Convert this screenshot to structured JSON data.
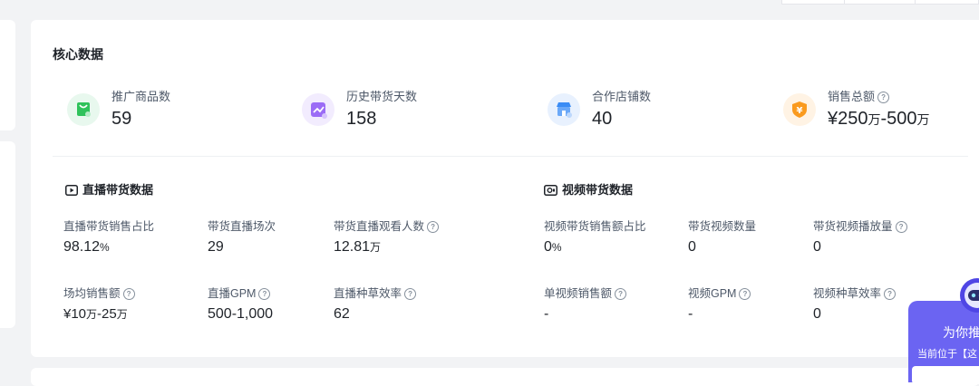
{
  "core": {
    "title": "核心数据",
    "metrics": [
      {
        "label": "推广商品数",
        "value": "59",
        "icon": "shopping-bag-icon",
        "color": "#2fc25b"
      },
      {
        "label": "历史带货天数",
        "value": "158",
        "icon": "trend-chart-icon",
        "color": "#9b6cf6"
      },
      {
        "label": "合作店铺数",
        "value": "40",
        "icon": "store-icon",
        "color": "#3a8cf5"
      },
      {
        "label": "销售总额",
        "value_prefix": "¥250",
        "unit1": "万",
        "value_mid": "-500",
        "unit2": "万",
        "icon": "yuan-shield-icon",
        "color": "#fa9a1e"
      }
    ]
  },
  "live": {
    "title": "直播带货数据",
    "icon": "play-icon",
    "cells": [
      {
        "label": "直播带货销售占比",
        "value": "98.12",
        "unit": "%"
      },
      {
        "label": "带货直播场次",
        "value": "29"
      },
      {
        "label": "带货直播观看人数",
        "value": "12.81",
        "unit": "万"
      },
      {
        "label": "场均销售额",
        "value": "¥10",
        "unit": "万",
        "value2": "-25",
        "unit2": "万"
      },
      {
        "label": "直播GPM",
        "value": "500-1,000"
      },
      {
        "label": "直播种草效率",
        "value": "62"
      }
    ]
  },
  "video": {
    "title": "视频带货数据",
    "icon": "video-camera-icon",
    "cells": [
      {
        "label": "视频带货销售额占比",
        "value": "0",
        "unit": "%"
      },
      {
        "label": "带货视频数量",
        "value": "0"
      },
      {
        "label": "带货视频播放量",
        "value": "0"
      },
      {
        "label": "单视频销售额",
        "value": "-"
      },
      {
        "label": "视频GPM",
        "value": "-"
      },
      {
        "label": "视频种草效率",
        "value": "0"
      }
    ]
  },
  "assistant": {
    "title": "为你推",
    "subtitle": "当前位于【这",
    "color": "#6b64f2"
  }
}
